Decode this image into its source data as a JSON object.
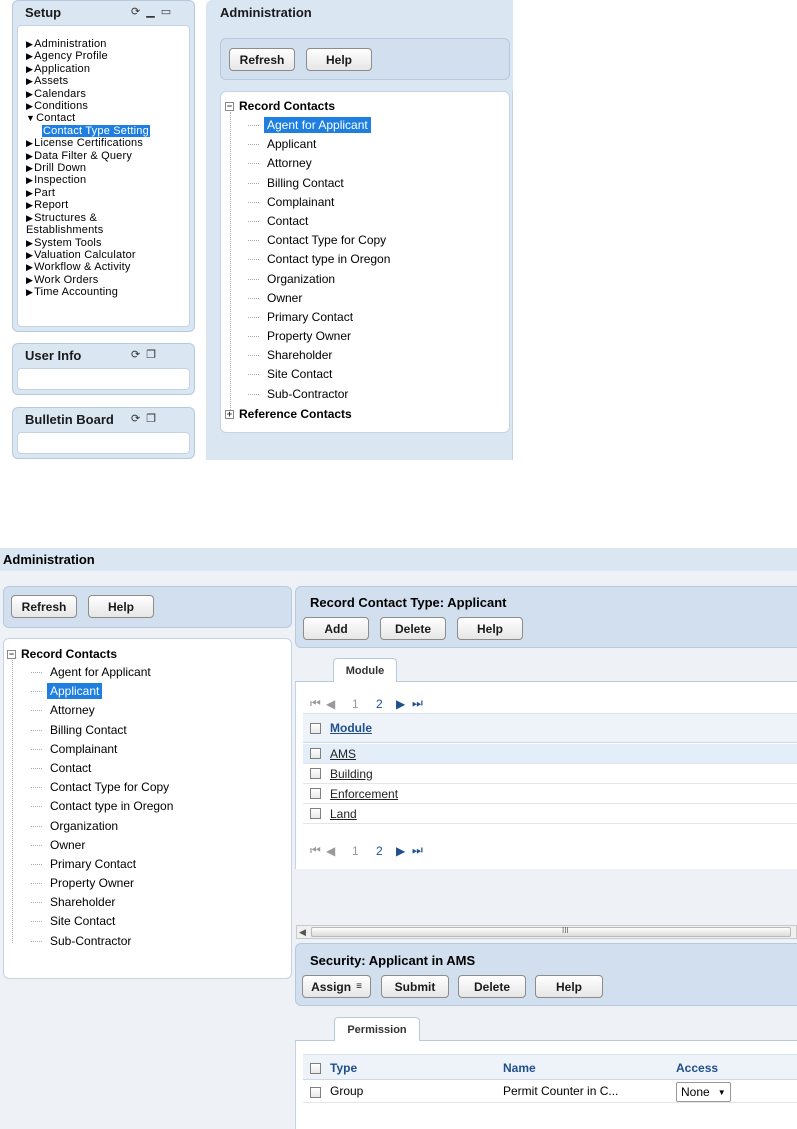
{
  "setup_panel": {
    "title": "Setup",
    "items": [
      {
        "label": "Administration",
        "arrow": "▶"
      },
      {
        "label": "Agency Profile",
        "arrow": "▶"
      },
      {
        "label": "Application",
        "arrow": "▶"
      },
      {
        "label": "Assets",
        "arrow": "▶"
      },
      {
        "label": "Calendars",
        "arrow": "▶"
      },
      {
        "label": "Conditions",
        "arrow": "▶"
      },
      {
        "label": "Contact",
        "arrow": "▼"
      },
      {
        "label": "Contact Type Setting",
        "arrow": ""
      },
      {
        "label": "License Certifications",
        "arrow": "▶"
      },
      {
        "label": "Data Filter & Query",
        "arrow": "▶"
      },
      {
        "label": "Drill Down",
        "arrow": "▶"
      },
      {
        "label": "Inspection",
        "arrow": "▶"
      },
      {
        "label": "Part",
        "arrow": "▶"
      },
      {
        "label": "Report",
        "arrow": "▶"
      },
      {
        "label": "Structures &",
        "arrow": "▶"
      },
      {
        "label": "Establishments",
        "arrow": ""
      },
      {
        "label": "System Tools",
        "arrow": "▶"
      },
      {
        "label": "Valuation Calculator",
        "arrow": "▶"
      },
      {
        "label": "Workflow & Activity",
        "arrow": "▶"
      },
      {
        "label": "Work Orders",
        "arrow": "▶"
      },
      {
        "label": "Time Accounting",
        "arrow": "▶"
      }
    ]
  },
  "user_info_panel": {
    "title": "User Info"
  },
  "bulletin_panel": {
    "title": "Bulletin Board"
  },
  "admin_top": {
    "title": "Administration",
    "refresh_label": "Refresh",
    "help_label": "Help",
    "tree_root": "Record Contacts",
    "tree_root_expander": "−",
    "tree_items": [
      "Agent for Applicant",
      "Applicant",
      "Attorney",
      "Billing Contact",
      "Complainant",
      "Contact",
      "Contact Type for Copy",
      "Contact type in Oregon",
      "Organization",
      "Owner",
      "Primary Contact",
      "Property Owner",
      "Shareholder",
      "Site Contact",
      "Sub-Contractor"
    ],
    "selected": "Agent for Applicant",
    "tree_root2": "Reference Contacts",
    "tree_root2_expander": "+"
  },
  "admin_bottom": {
    "title": "Administration",
    "refresh_label": "Refresh",
    "help_label": "Help",
    "tree_root": "Record Contacts",
    "tree_root_expander": "−",
    "tree_items": [
      "Agent for Applicant",
      "Applicant",
      "Attorney",
      "Billing Contact",
      "Complainant",
      "Contact",
      "Contact Type for Copy",
      "Contact type in Oregon",
      "Organization",
      "Owner",
      "Primary Contact",
      "Property Owner",
      "Shareholder",
      "Site Contact",
      "Sub-Contractor"
    ],
    "selected": "Applicant"
  },
  "record_contact_type": {
    "title": "Record Contact Type: Applicant",
    "add_label": "Add",
    "delete_label": "Delete",
    "help_label": "Help",
    "tab_label": "Module",
    "pager": {
      "page1": "1",
      "page2": "2"
    },
    "column_header": "Module",
    "rows": [
      "AMS",
      "Building",
      "Enforcement",
      "Land"
    ],
    "scrollbar_grip": "III"
  },
  "security": {
    "title": "Security: Applicant in AMS",
    "assign_label": "Assign",
    "submit_label": "Submit",
    "delete_label": "Delete",
    "help_label": "Help",
    "tab_label": "Permission",
    "headers": {
      "type": "Type",
      "name": "Name",
      "access": "Access"
    },
    "rows": [
      {
        "type": "Group",
        "name": "Permit Counter in C...",
        "access": "None"
      }
    ]
  }
}
